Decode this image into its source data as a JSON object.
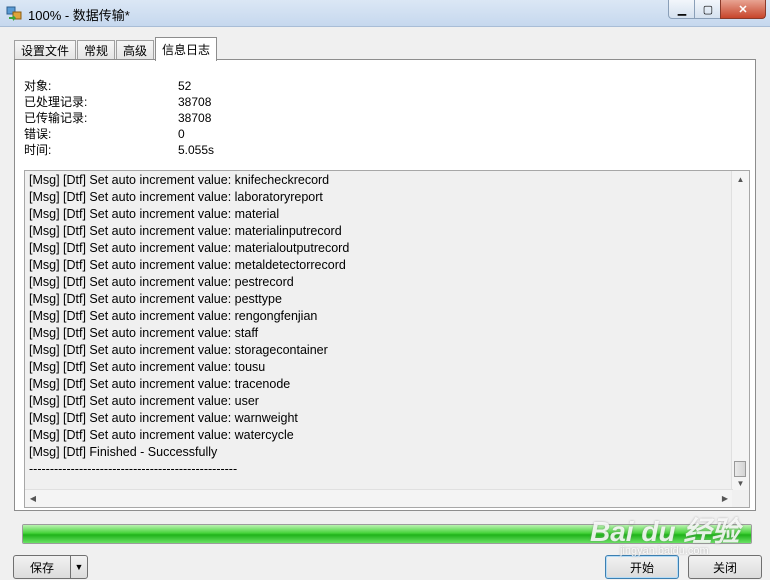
{
  "window": {
    "title": "100% - 数据传输*",
    "minimize_glyph": "▁",
    "maximize_glyph": "▢",
    "close_glyph": "✕"
  },
  "tabs": [
    {
      "label": "设置文件",
      "active": false
    },
    {
      "label": "常规",
      "active": false
    },
    {
      "label": "高级",
      "active": false
    },
    {
      "label": "信息日志",
      "active": true
    }
  ],
  "stats": [
    {
      "label": "对象:",
      "value": "52"
    },
    {
      "label": "已处理记录:",
      "value": "38708"
    },
    {
      "label": "已传输记录:",
      "value": "38708"
    },
    {
      "label": "错误:",
      "value": "0"
    },
    {
      "label": "时间:",
      "value": "5.055s"
    }
  ],
  "log": [
    "[Msg] [Dtf] Set auto increment value: knifecheckrecord",
    "[Msg] [Dtf] Set auto increment value: laboratoryreport",
    "[Msg] [Dtf] Set auto increment value: material",
    "[Msg] [Dtf] Set auto increment value: materialinputrecord",
    "[Msg] [Dtf] Set auto increment value: materialoutputrecord",
    "[Msg] [Dtf] Set auto increment value: metaldetectorrecord",
    "[Msg] [Dtf] Set auto increment value: pestrecord",
    "[Msg] [Dtf] Set auto increment value: pesttype",
    "[Msg] [Dtf] Set auto increment value: rengongfenjian",
    "[Msg] [Dtf] Set auto increment value: staff",
    "[Msg] [Dtf] Set auto increment value: storagecontainer",
    "[Msg] [Dtf] Set auto increment value: tousu",
    "[Msg] [Dtf] Set auto increment value: tracenode",
    "[Msg] [Dtf] Set auto increment value: user",
    "[Msg] [Dtf] Set auto increment value: warnweight",
    "[Msg] [Dtf] Set auto increment value: watercycle",
    "[Msg] [Dtf] Finished - Successfully",
    "--------------------------------------------------"
  ],
  "progress": {
    "fraction": 1.0,
    "color": "#2ec425"
  },
  "buttons": {
    "save": "保存",
    "save_dropdown_glyph": "▼",
    "start": "开始",
    "close": "关闭"
  },
  "scroll_glyphs": {
    "up": "▲",
    "down": "▼",
    "left": "◀",
    "right": "▶"
  },
  "watermark": {
    "brand": "Bai du 经验",
    "url": "jingyan.baidu.com"
  }
}
